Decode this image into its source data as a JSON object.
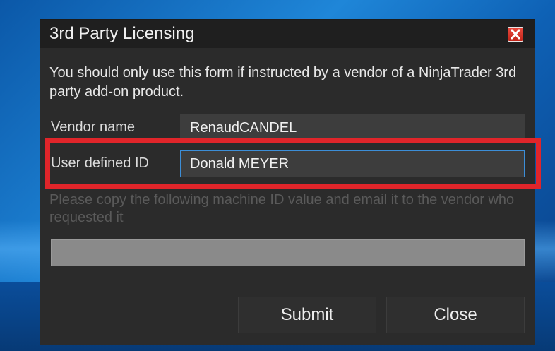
{
  "dialog": {
    "title": "3rd Party Licensing",
    "info_text": "You should only use this form if instructed by a vendor of a NinjaTrader 3rd party add-on product.",
    "vendor_name_label": "Vendor name",
    "vendor_name_value": "RenaudCANDEL",
    "user_id_label": "User defined ID",
    "user_id_value": "Donald MEYER",
    "hint_text": "Please copy the following machine ID value and email it to the vendor who requested it",
    "machine_id_value": "",
    "submit_label": "Submit",
    "close_label": "Close"
  },
  "icons": {
    "close": "close-icon"
  },
  "colors": {
    "dialog_bg": "#2b2b2b",
    "titlebar_bg": "#1f1f1f",
    "highlight": "#e0252a",
    "focus_border": "#3c8ed8",
    "close_button": "#d2352b"
  }
}
